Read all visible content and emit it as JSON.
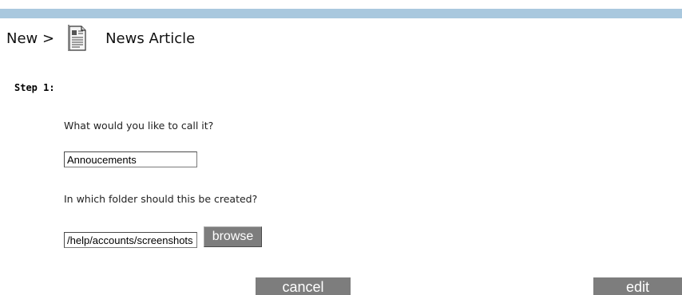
{
  "breadcrumb": {
    "parent": "New >",
    "current": "News Article",
    "icon": "news-article-document-icon"
  },
  "step": {
    "label": "Step 1:"
  },
  "name_field": {
    "question": "What would you like to call it?",
    "value": "Annoucements"
  },
  "folder_field": {
    "question": "In which folder should this be created?",
    "value": "/help/accounts/screenshots"
  },
  "buttons": {
    "browse": "browse",
    "cancel": "cancel",
    "edit": "edit"
  },
  "colors": {
    "top_bar": "#a9c8de",
    "button_bg": "#7d7d7d",
    "button_text": "#ffffff"
  }
}
